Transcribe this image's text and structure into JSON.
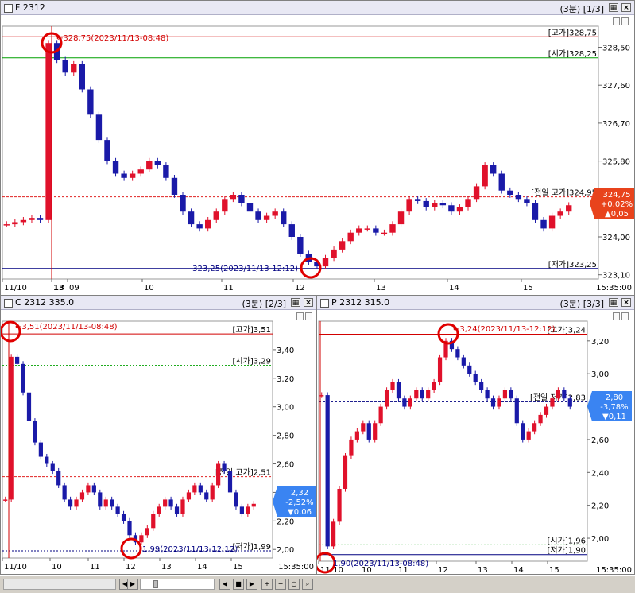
{
  "panels": {
    "futures": {
      "title": "F 2312",
      "period": "(3분) [1/3]",
      "high_marker": "328,75(2023/11/13-08:48)",
      "low_marker": "323,25(2023/11/13-12:12)",
      "ref_labels": [
        "[고가]328,75",
        "[시가]328,25",
        "[전일 고가]324,95",
        "[저가]323,25"
      ],
      "current_badge": [
        "324,75",
        "+0,02%",
        "▲0,05"
      ],
      "chart_data": {
        "type": "candlestick",
        "y_ticks": [
          "328,50",
          "327,60",
          "326,70",
          "325,80",
          "324,00",
          "323,10"
        ],
        "y_range": [
          323.0,
          329.0
        ],
        "x_ticks": [
          "11/10",
          "13",
          "09",
          "10",
          "11",
          "12",
          "13",
          "14",
          "15",
          "15:35:00"
        ],
        "ref_lines": {
          "high": 328.75,
          "open": 328.25,
          "prev_high": 324.95,
          "low": 323.25
        },
        "close_path": [
          324.3,
          324.35,
          324.4,
          324.45,
          324.4,
          328.6,
          328.2,
          327.9,
          328.1,
          327.5,
          326.9,
          326.3,
          325.8,
          325.5,
          325.4,
          325.5,
          325.6,
          325.8,
          325.7,
          325.4,
          325.0,
          324.6,
          324.3,
          324.2,
          324.4,
          324.6,
          324.9,
          325.0,
          324.8,
          324.6,
          324.4,
          324.5,
          324.6,
          324.3,
          324.0,
          323.6,
          323.4,
          323.3,
          323.5,
          323.7,
          323.9,
          324.1,
          324.2,
          324.2,
          324.1,
          324.1,
          324.3,
          324.6,
          324.9,
          324.85,
          324.7,
          324.8,
          324.75,
          324.6,
          324.7,
          324.9,
          325.2,
          325.7,
          325.5,
          325.1,
          325.0,
          324.9,
          324.8,
          324.4,
          324.2,
          324.5,
          324.6,
          324.75
        ]
      }
    },
    "call": {
      "title": "C 2312 335.0",
      "period": "(3분) [2/3]",
      "high_marker": "3,51(2023/11/13-08:48)",
      "low_marker": "1,99(2023/11/13-12:12)",
      "ref_labels": [
        "[고가]3,51",
        "[시가]3,29",
        "[전일 고가]2,51",
        "[저가]1,99"
      ],
      "current_badge": [
        "2,32",
        "-2,52%",
        "▼0,06"
      ],
      "chart_data": {
        "type": "candlestick",
        "y_ticks": [
          "3,40",
          "3,20",
          "3,00",
          "2,80",
          "2,60",
          "2,40",
          "2,20",
          "2,00"
        ],
        "y_range": [
          1.94,
          3.6
        ],
        "x_ticks": [
          "11/10",
          "10",
          "11",
          "12",
          "13",
          "14",
          "15",
          "15:35:00"
        ],
        "ref_lines": {
          "high": 3.51,
          "open": 3.29,
          "prev_high": 2.51,
          "low": 1.99
        },
        "close_path": [
          2.35,
          3.35,
          3.3,
          3.1,
          2.9,
          2.75,
          2.65,
          2.6,
          2.55,
          2.45,
          2.35,
          2.3,
          2.35,
          2.4,
          2.45,
          2.4,
          2.3,
          2.35,
          2.3,
          2.25,
          2.2,
          2.1,
          2.05,
          2.1,
          2.15,
          2.25,
          2.3,
          2.35,
          2.3,
          2.25,
          2.35,
          2.4,
          2.45,
          2.4,
          2.35,
          2.45,
          2.6,
          2.55,
          2.4,
          2.3,
          2.25,
          2.3,
          2.32
        ]
      }
    },
    "put": {
      "title": "P 2312 315.0",
      "period": "(3분) [3/3]",
      "high_marker": "3,24(2023/11/13-12:12)",
      "low_marker": "1,90(2023/11/13-08:48)",
      "ref_labels": [
        "[고가]3,24",
        "[전일 저가]2,83",
        "[시가]1,96",
        "[저가]1,90"
      ],
      "current_badge": [
        "2,80",
        "-3,78%",
        "▼0,11"
      ],
      "chart_data": {
        "type": "candlestick",
        "y_ticks": [
          "3,20",
          "3,00",
          "2,80",
          "2,60",
          "2,40",
          "2,20",
          "2,00"
        ],
        "y_range": [
          1.86,
          3.32
        ],
        "x_ticks": [
          "11/10",
          "10",
          "11",
          "12",
          "13",
          "14",
          "15",
          "15:35:00"
        ],
        "ref_lines": {
          "high": 3.24,
          "prev_low": 2.83,
          "open": 1.96,
          "low": 1.9
        },
        "close_path": [
          2.87,
          1.95,
          2.1,
          2.3,
          2.5,
          2.6,
          2.65,
          2.7,
          2.6,
          2.7,
          2.8,
          2.9,
          2.95,
          2.85,
          2.8,
          2.85,
          2.9,
          2.85,
          2.9,
          2.95,
          3.1,
          3.2,
          3.15,
          3.1,
          3.05,
          3.0,
          2.95,
          2.9,
          2.85,
          2.8,
          2.85,
          2.9,
          2.85,
          2.7,
          2.6,
          2.65,
          2.7,
          2.75,
          2.8,
          2.85,
          2.9,
          2.85,
          2.8
        ]
      }
    }
  },
  "colors": {
    "up": "#e0112b",
    "down": "#1a1aa8",
    "high_line": "#d20000",
    "open_line": "#00a000",
    "prev_line": "#e02020",
    "low_line": "#000080",
    "badge_up": "#e8431c",
    "badge_down": "#3a84f2"
  },
  "icons": [
    "checkbox-icon",
    "grid-icon",
    "close-icon",
    "scroll-left-icon",
    "scroll-right-icon",
    "stop-icon",
    "play-icon",
    "zoom-in-icon",
    "zoom-out-icon",
    "zoom-reset-icon",
    "search-icon"
  ]
}
